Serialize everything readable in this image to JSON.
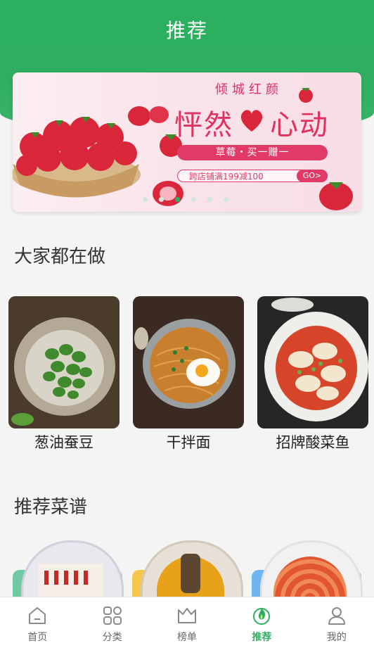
{
  "header": {
    "title": "推荐"
  },
  "banner": {
    "brand": "倾城红颜",
    "headline_left": "怦然",
    "headline_right": "心动",
    "promo_main": "草莓・买一赠一",
    "promo_sub": "跨店铺满199减100",
    "go_label": "GO>",
    "dot_count": 6,
    "active_dot": 2
  },
  "sections": {
    "popular_title": "大家都在做",
    "recommend_title": "推荐菜谱"
  },
  "popular": [
    {
      "name": "葱油蚕豆"
    },
    {
      "name": "干拌面"
    },
    {
      "name": "招牌酸菜鱼"
    }
  ],
  "tabbar": {
    "items": [
      {
        "label": "首页",
        "icon": "home-icon"
      },
      {
        "label": "分类",
        "icon": "grid-icon"
      },
      {
        "label": "榜单",
        "icon": "crown-icon"
      },
      {
        "label": "推荐",
        "icon": "flame-icon"
      },
      {
        "label": "我的",
        "icon": "user-icon"
      }
    ],
    "active_index": 3
  },
  "colors": {
    "brand_green": "#2fae60",
    "promo_red": "#e23a68"
  }
}
